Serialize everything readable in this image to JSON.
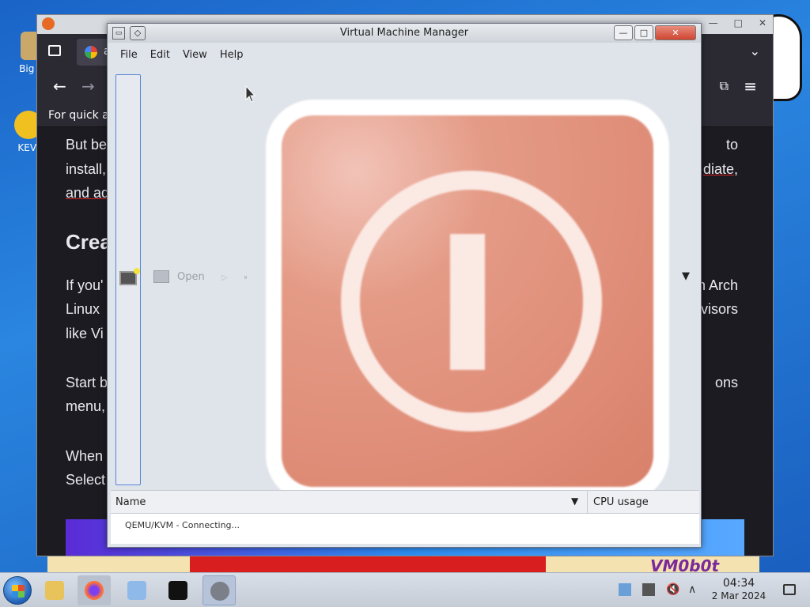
{
  "desktop": {
    "icons": [
      {
        "label": "Big\nDe"
      },
      {
        "label": "KEVI"
      }
    ],
    "wallpaper_text": "VM0b0t"
  },
  "browser": {
    "tab_label": "a",
    "bookmarks_hint": "For quick a",
    "content": {
      "line1_left": "But be",
      "line1_right": "to",
      "line2_left": "install,",
      "line2_right": "diate,",
      "line3_left": "and ad",
      "heading": "Crea",
      "line4_left": "If you'",
      "line4_right": "n Arch",
      "line5_left": "Linux",
      "line5_right": "visors",
      "line6_left": "like Vi",
      "line7_left": "Start b",
      "line7_right": "ons",
      "line8_left": "menu,",
      "line9_left": "When",
      "line10_left": "Select"
    }
  },
  "vmm": {
    "title": "Virtual Machine Manager",
    "menu": [
      "File",
      "Edit",
      "View",
      "Help"
    ],
    "toolbar": {
      "open_label": "Open"
    },
    "list": {
      "col_name": "Name",
      "col_cpu": "CPU usage",
      "rows": [
        "QEMU/KVM - Connecting..."
      ]
    },
    "window_buttons": {
      "minimize": "—",
      "maximize": "□",
      "close": "✕"
    }
  },
  "taskbar": {
    "clock_time": "04:34",
    "clock_date": "2 Mar 2024",
    "items": [
      "start",
      "file-manager",
      "firefox",
      "control-panel",
      "terminal",
      "virt-manager"
    ]
  },
  "colors": {
    "vmm_bg": "#dfe3ea",
    "close_button": "#cf4631",
    "taskbar": "#d9dfe8"
  }
}
